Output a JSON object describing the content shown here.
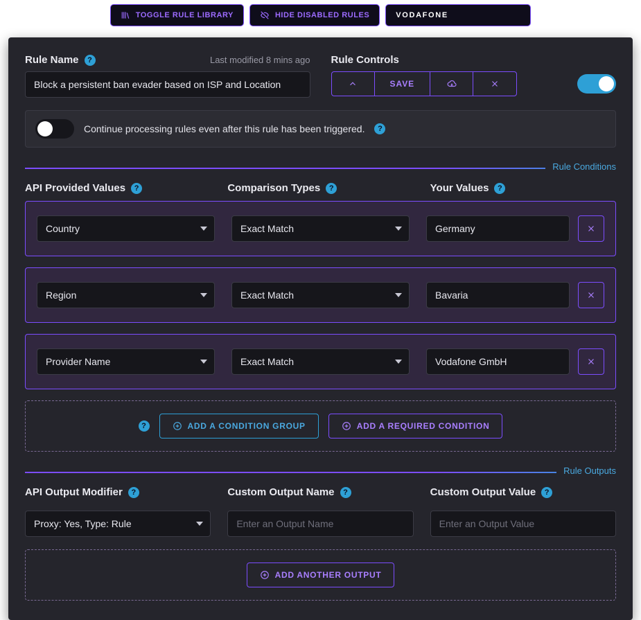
{
  "topbar": {
    "toggle_library": "Toggle Rule Library",
    "hide_disabled": "Hide Disabled Rules",
    "search_value": "VODAFONE"
  },
  "header": {
    "rule_name_label": "Rule Name",
    "last_modified": "Last modified 8 mins ago",
    "rule_name_value": "Block a persistent ban evader based on ISP and Location",
    "rule_controls_label": "Rule Controls",
    "save": "SAVE",
    "continue_text": "Continue processing rules even after this rule has been triggered."
  },
  "sections": {
    "conditions": "Rule Conditions",
    "outputs": "Rule Outputs"
  },
  "cond_cols": {
    "api": "API Provided Values",
    "comp": "Comparison Types",
    "your": "Your Values"
  },
  "conditions": [
    {
      "api": "Country",
      "comp": "Exact Match",
      "val": "Germany"
    },
    {
      "api": "Region",
      "comp": "Exact Match",
      "val": "Bavaria"
    },
    {
      "api": "Provider Name",
      "comp": "Exact Match",
      "val": "Vodafone GmbH"
    }
  ],
  "cond_actions": {
    "add_group": "Add a Condition Group",
    "add_required": "Add a Required Condition"
  },
  "out_labels": {
    "modifier": "API Output Modifier",
    "name": "Custom Output Name",
    "value": "Custom Output Value",
    "name_ph": "Enter an Output Name",
    "value_ph": "Enter an Output Value"
  },
  "output": {
    "modifier": "Proxy: Yes, Type: Rule"
  },
  "add_output": "Add Another Output",
  "help": "?"
}
